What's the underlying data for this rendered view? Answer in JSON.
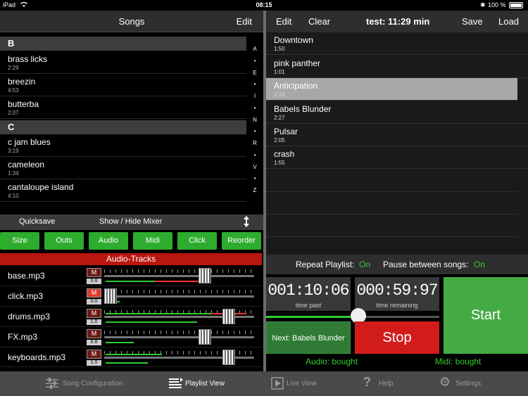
{
  "status": {
    "carrier": "iPad",
    "time": "08:15",
    "battery": "100 %"
  },
  "songs_panel": {
    "title": "Songs",
    "edit_label": "Edit",
    "sections": [
      {
        "letter": "B",
        "songs": [
          {
            "name": "brass licks",
            "duration": "2:29"
          },
          {
            "name": "breezin",
            "duration": "4:53"
          },
          {
            "name": "butterba",
            "duration": "2:07"
          }
        ]
      },
      {
        "letter": "C",
        "songs": [
          {
            "name": "c jam blues",
            "duration": "3:19"
          },
          {
            "name": "cameleon",
            "duration": "1:34"
          },
          {
            "name": "cantaloupe island",
            "duration": "4:10"
          }
        ]
      }
    ],
    "index": [
      "A",
      "•",
      "E",
      "•",
      "I",
      "•",
      "N",
      "•",
      "R",
      "•",
      "V",
      "•",
      "Z"
    ]
  },
  "mixer_bar": {
    "quicksave": "Quicksave",
    "show_hide": "Show / Hide Mixer"
  },
  "mixer_buttons": [
    "Size",
    "Outs",
    "Audio",
    "Midi",
    "Click",
    "Reorder"
  ],
  "audio_tracks": {
    "header": "Audio-Tracks",
    "tracks": [
      {
        "name": "base.mp3",
        "mute": "M",
        "muted": false,
        "volume": "0.8"
      },
      {
        "name": "click.mp3",
        "mute": "M",
        "muted": true,
        "volume": "0.0"
      },
      {
        "name": "drums.mp3",
        "mute": "M",
        "muted": false,
        "volume": "1.0"
      },
      {
        "name": "FX.mp3",
        "mute": "M",
        "muted": false,
        "volume": "0.8"
      },
      {
        "name": "keyboards.mp3",
        "mute": "M",
        "muted": false,
        "volume": "1.0"
      }
    ]
  },
  "playlist_header": {
    "edit": "Edit",
    "clear": "Clear",
    "title": "test:  11:29 min",
    "save": "Save",
    "load": "Load"
  },
  "playlist": [
    {
      "name": "Downtown",
      "duration": "1:50",
      "selected": false
    },
    {
      "name": "pink panther",
      "duration": "1:01",
      "selected": false
    },
    {
      "name": "Anticipation",
      "duration": "2:10",
      "selected": true
    },
    {
      "name": "Babels Blunder",
      "duration": "2:27",
      "selected": false
    },
    {
      "name": "Pulsar",
      "duration": "2:05",
      "selected": false
    },
    {
      "name": "crash",
      "duration": "1:55",
      "selected": false
    }
  ],
  "options": {
    "repeat_label": "Repeat Playlist:",
    "repeat_value": "On",
    "pause_label": "Pause between songs:",
    "pause_value": "On"
  },
  "transport": {
    "time_past": "001:10:06",
    "time_past_label": "time past",
    "time_remaining": "000:59:97",
    "time_remaining_label": "time remaining",
    "position": 0.53,
    "next_label": "Next: Babels Blunder",
    "stop_label": "Stop",
    "start_label": "Start",
    "audio_status": "Audio: bought",
    "midi_status": "Midi: bought"
  },
  "tabs": [
    {
      "label": "Song Configuration",
      "icon": "sliders-icon",
      "active": false
    },
    {
      "label": "Playlist View",
      "icon": "playlist-icon",
      "active": true
    },
    {
      "label": "Live View",
      "icon": "play-icon",
      "active": false
    },
    {
      "label": "Help",
      "icon": "question-icon",
      "active": false
    },
    {
      "label": "Settings",
      "icon": "gear-icon",
      "active": false
    }
  ],
  "colors": {
    "accent_green": "#33cc33",
    "button_green": "#2eac2e",
    "stop_red": "#d21c1c",
    "track_header_red": "#b8160f"
  }
}
